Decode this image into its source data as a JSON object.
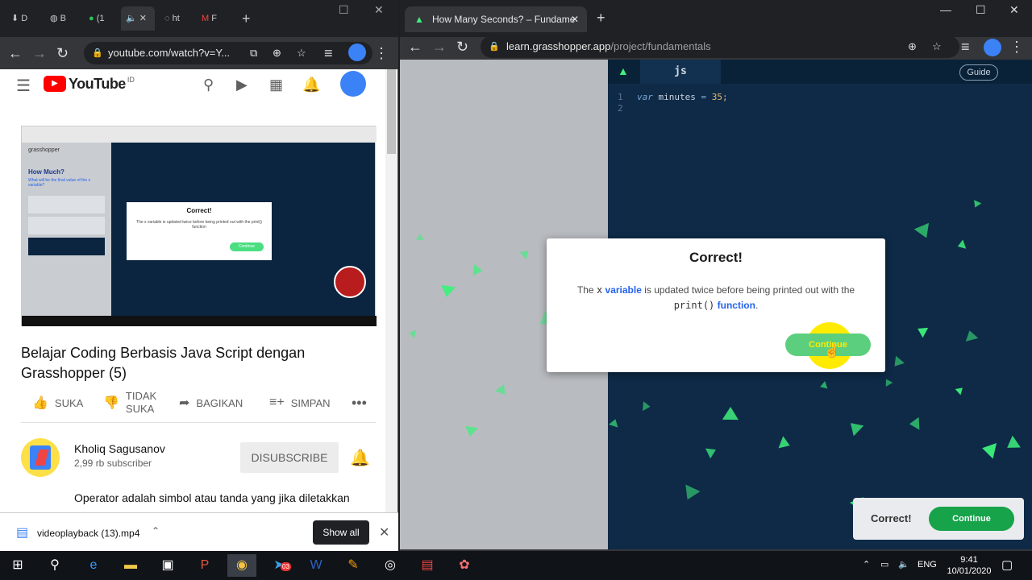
{
  "left_window": {
    "tabs": [
      {
        "label": "D"
      },
      {
        "label": "B"
      },
      {
        "label": "(1"
      },
      {
        "label": ""
      },
      {
        "label": "ht"
      },
      {
        "label": "F"
      }
    ],
    "url": "youtube.com/watch?v=Y...",
    "youtube": {
      "logo_text": "YouTube",
      "region": "ID",
      "video": {
        "inner_title": "How Much?",
        "inner_subtitle": "What will be the final value of the x variable?",
        "inner_brand": "grasshopper",
        "inner_dialog_title": "Correct!",
        "inner_dialog_body": "The x variable is updated twice before being printed out with the print() function",
        "inner_continue": "Continue"
      },
      "title": "Belajar Coding Berbasis Java Script dengan Grasshopper (5)",
      "actions": {
        "like": "SUKA",
        "dislike": "TIDAK SUKA",
        "share": "BAGIKAN",
        "save": "SIMPAN"
      },
      "channel": {
        "name": "Kholiq Sagusanov",
        "subscribers": "2,99 rb subscriber",
        "subscribe_label": "DISUBSCRIBE"
      },
      "description": "Operator adalah simbol atau tanda yang jika diletakkan"
    },
    "download": {
      "filename": "videoplayback (13).mp4",
      "show_all": "Show all"
    }
  },
  "right_window": {
    "tab_title": "How Many Seconds? – Fundame",
    "url_host": "learn.grasshopper.app",
    "url_path": "/project/fundamentals",
    "editor": {
      "tab": "js",
      "guide": "Guide",
      "lines": [
        "1",
        "2"
      ],
      "code_kw": "var",
      "code_name": "minutes",
      "code_op": "=",
      "code_num": "35;"
    },
    "modal": {
      "title": "Correct!",
      "text_1": "The ",
      "code_x": "x",
      "word_variable": "variable",
      "text_2": " is updated twice before being printed out with the",
      "code_print": "print()",
      "word_function": "function",
      "continue": "Continue"
    },
    "toast": {
      "text": "Correct!",
      "button": "Continue"
    }
  },
  "taskbar": {
    "lang": "ENG",
    "time": "9:41",
    "date": "10/01/2020",
    "telegram_badge": "03"
  },
  "colors": {
    "editor_bg": "#0e2a47",
    "confetti": "#3ef07c",
    "continue_green": "#16a34a",
    "highlight": "#ffeb00"
  }
}
